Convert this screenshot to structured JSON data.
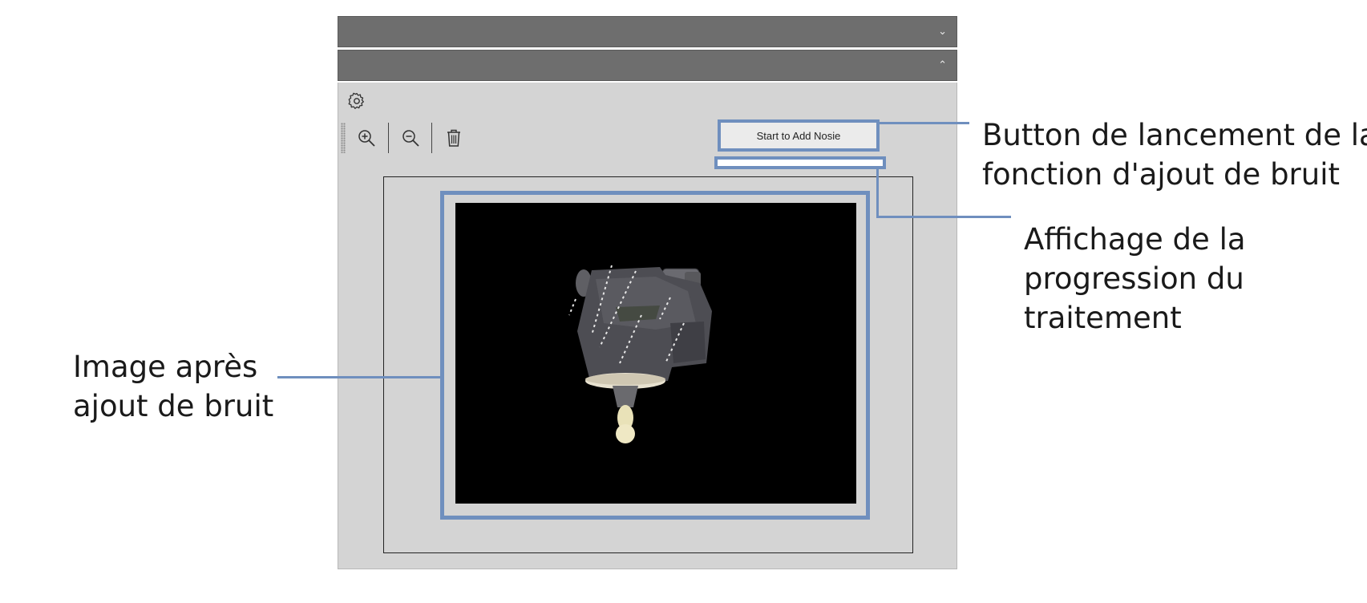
{
  "panels": {
    "section1": {
      "chevron": "⌄"
    },
    "section2": {
      "chevron": "⌃"
    }
  },
  "toolbar": {
    "settings_icon": "gear-icon",
    "zoom_in_icon": "zoom-in-icon",
    "zoom_out_icon": "zoom-out-icon",
    "delete_icon": "trash-icon"
  },
  "actions": {
    "start_label": "Start to Add Nosie"
  },
  "progress": {
    "value": 0
  },
  "annotations": {
    "button_line1": "Button de lancement de la",
    "button_line2": "fonction d'ajout de bruit",
    "progress_line1": "Affichage de la",
    "progress_line2": "progression du",
    "progress_line3": "traitement",
    "image_line1": "Image après",
    "image_line2": "ajout de bruit"
  },
  "colors": {
    "highlight": "#6f8fbe",
    "header": "#6e6e6e",
    "panel": "#d4d4d4"
  }
}
